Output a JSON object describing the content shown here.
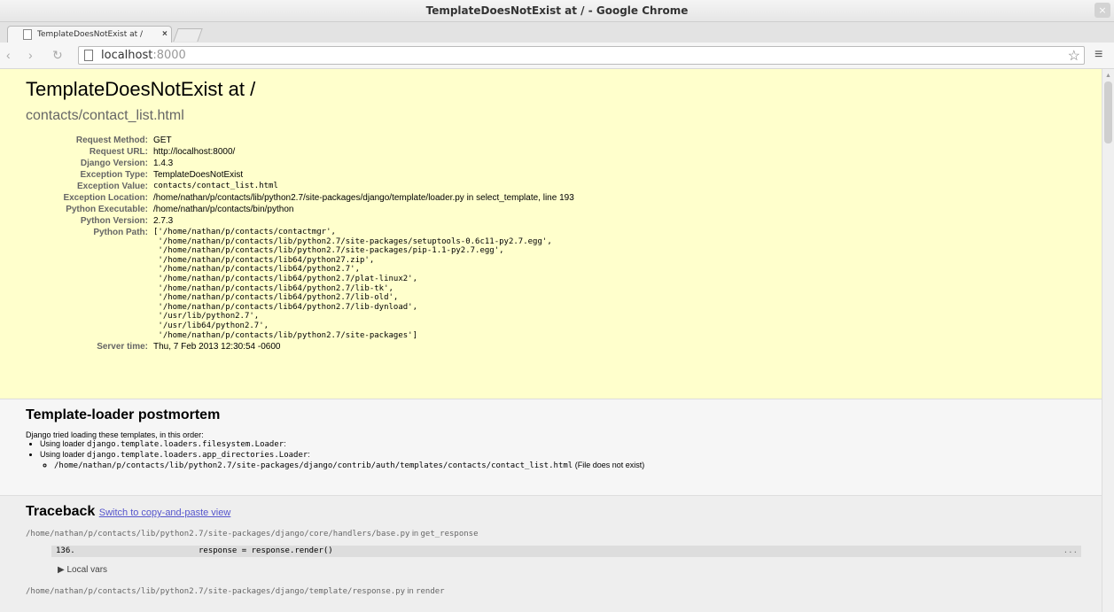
{
  "window": {
    "title": "TemplateDoesNotExist at / - Google Chrome",
    "close_glyph": "×"
  },
  "tab": {
    "title": "TemplateDoesNotExist at /",
    "close_glyph": "×"
  },
  "toolbar": {
    "back": "‹",
    "forward": "›",
    "reload": "↻",
    "url_host": "localhost",
    "url_port": ":8000",
    "star": "☆",
    "menu": "≡"
  },
  "summary": {
    "title": "TemplateDoesNotExist at /",
    "subtitle": "contacts/contact_list.html",
    "rows": [
      {
        "label": "Request Method:",
        "value": "GET"
      },
      {
        "label": "Request URL:",
        "value": "http://localhost:8000/"
      },
      {
        "label": "Django Version:",
        "value": "1.4.3"
      },
      {
        "label": "Exception Type:",
        "value": "TemplateDoesNotExist"
      },
      {
        "label": "Exception Value:",
        "value": "contacts/contact_list.html"
      },
      {
        "label": "Exception Location:",
        "value": "/home/nathan/p/contacts/lib/python2.7/site-packages/django/template/loader.py in select_template, line 193"
      },
      {
        "label": "Python Executable:",
        "value": "/home/nathan/p/contacts/bin/python"
      },
      {
        "label": "Python Version:",
        "value": "2.7.3"
      },
      {
        "label": "Python Path:"
      },
      {
        "label": "Server time:",
        "value": "Thu, 7 Feb 2013 12:30:54 -0600"
      }
    ],
    "python_path": [
      "['/home/nathan/p/contacts/contactmgr',",
      " '/home/nathan/p/contacts/lib/python2.7/site-packages/setuptools-0.6c11-py2.7.egg',",
      " '/home/nathan/p/contacts/lib/python2.7/site-packages/pip-1.1-py2.7.egg',",
      " '/home/nathan/p/contacts/lib64/python27.zip',",
      " '/home/nathan/p/contacts/lib64/python2.7',",
      " '/home/nathan/p/contacts/lib64/python2.7/plat-linux2',",
      " '/home/nathan/p/contacts/lib64/python2.7/lib-tk',",
      " '/home/nathan/p/contacts/lib64/python2.7/lib-old',",
      " '/home/nathan/p/contacts/lib64/python2.7/lib-dynload',",
      " '/usr/lib/python2.7',",
      " '/usr/lib64/python2.7',",
      " '/home/nathan/p/contacts/lib/python2.7/site-packages']"
    ]
  },
  "postmortem": {
    "title": "Template-loader postmortem",
    "intro": "Django tried loading these templates, in this order:",
    "loader_prefix": "Using loader ",
    "loader1": "django.template.loaders.filesystem.Loader",
    "loader2": "django.template.loaders.app_directories.Loader",
    "colon": ":",
    "tried_path": "/home/nathan/p/contacts/lib/python2.7/site-packages/django/contrib/auth/templates/contacts/contact_list.html",
    "tried_status": " (File does not exist)"
  },
  "traceback": {
    "title": "Traceback",
    "switch_link": "Switch to copy-and-paste view",
    "frame1_file": "/home/nathan/p/contacts/lib/python2.7/site-packages/django/core/handlers/base.py",
    "frame1_in": " in ",
    "frame1_func": "get_response",
    "frame1_lineno": "136.",
    "frame1_code": "response = response.render()",
    "frame1_dots": "...",
    "local_vars": "▶ Local vars",
    "frame2_file": "/home/nathan/p/contacts/lib/python2.7/site-packages/django/template/response.py",
    "frame2_in": " in ",
    "frame2_func": "render"
  }
}
